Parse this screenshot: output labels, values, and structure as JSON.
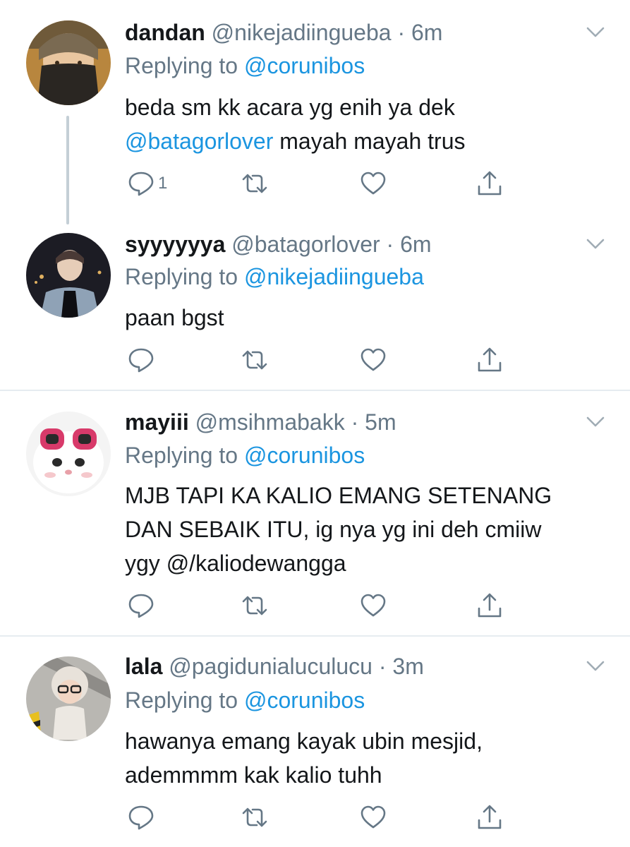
{
  "tweets": [
    {
      "name": "dandan",
      "handle": "@nikejadiingueba",
      "dot": "·",
      "time": "6m",
      "replying_prefix": "Replying to",
      "replying_to": "@corunibos",
      "text_parts": [
        "beda sm kk acara yg enih ya dek",
        "@batagorlover",
        " mayah mayah trus"
      ],
      "reply_count": "1"
    },
    {
      "name": "syyyyyya",
      "handle": "@batagorlover",
      "dot": "·",
      "time": "6m",
      "replying_prefix": "Replying to",
      "replying_to": "@nikejadiingueba",
      "text": "paan bgst"
    },
    {
      "name": "mayiii",
      "handle": "@msihmabakk",
      "dot": "·",
      "time": "5m",
      "replying_prefix": "Replying to",
      "replying_to": "@corunibos",
      "text_lines": [
        "MJB TAPI KA KALIO EMANG SETENANG",
        "DAN SEBAIK ITU, ig nya yg ini deh cmiiw",
        "ygy @/kaliodewangga"
      ]
    },
    {
      "name": "lala",
      "handle": "@pagidunialuculucu",
      "dot": "·",
      "time": "3m",
      "replying_prefix": "Replying to",
      "replying_to": "@corunibos",
      "text_lines": [
        "hawanya emang kayak ubin mesjid,",
        "ademmmm kak kalio tuhh"
      ]
    }
  ],
  "colors": {
    "text": "#14171a",
    "secondary": "#657786",
    "link": "#1b95e0",
    "divider": "#e6ecf0",
    "thread_line": "#c4cfd6"
  },
  "icons": {
    "reply": "reply-icon",
    "retweet": "retweet-icon",
    "like": "heart-icon",
    "share": "share-icon",
    "more": "chevron-down-icon"
  }
}
